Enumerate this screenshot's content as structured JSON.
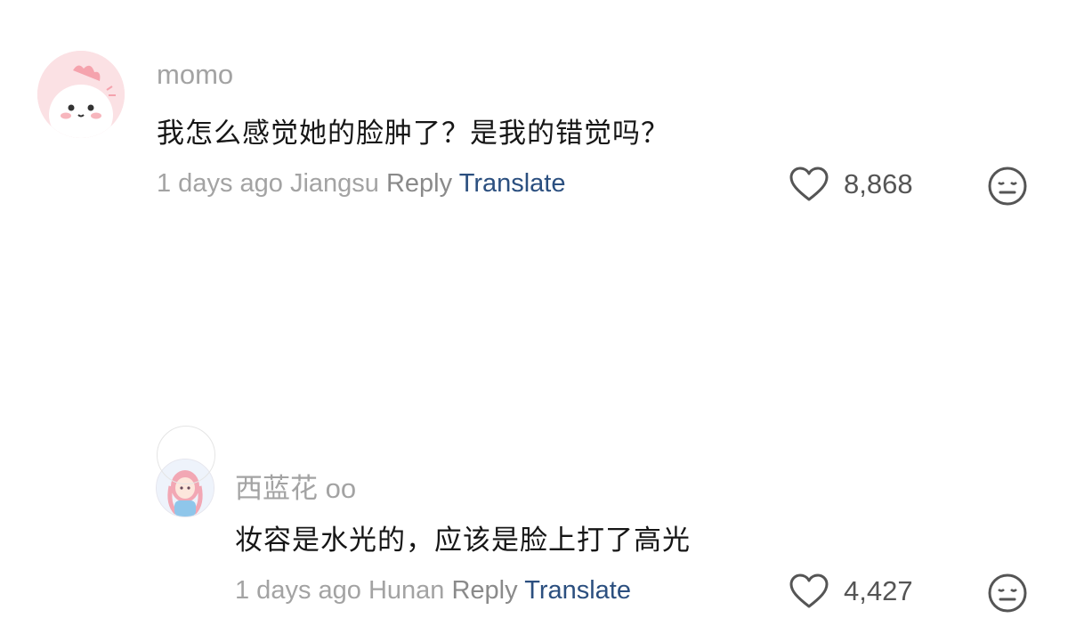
{
  "comments": [
    {
      "username": "momo",
      "text": "我怎么感觉她的脸肿了？是我的错觉吗？",
      "time": "1 days ago",
      "location": "Jiangsu",
      "reply_label": "Reply",
      "translate_label": "Translate",
      "likes": "8,868",
      "avatar_icon": "cartoon-dinosaur-avatar",
      "like_icon": "heart-outline-icon",
      "dislike_icon": "neutral-face-icon"
    },
    {
      "username": "西蓝花 oo",
      "text": "妆容是水光的，应该是脸上打了高光",
      "time": "1 days ago",
      "location": "Hunan",
      "reply_label": "Reply",
      "translate_label": "Translate",
      "likes": "4,427",
      "avatar_icon": "anime-girl-avatar",
      "like_icon": "heart-outline-icon",
      "dislike_icon": "neutral-face-icon"
    }
  ],
  "colors": {
    "username": "#a3a3a3",
    "translate": "#2b4f7f",
    "text": "#161616"
  }
}
